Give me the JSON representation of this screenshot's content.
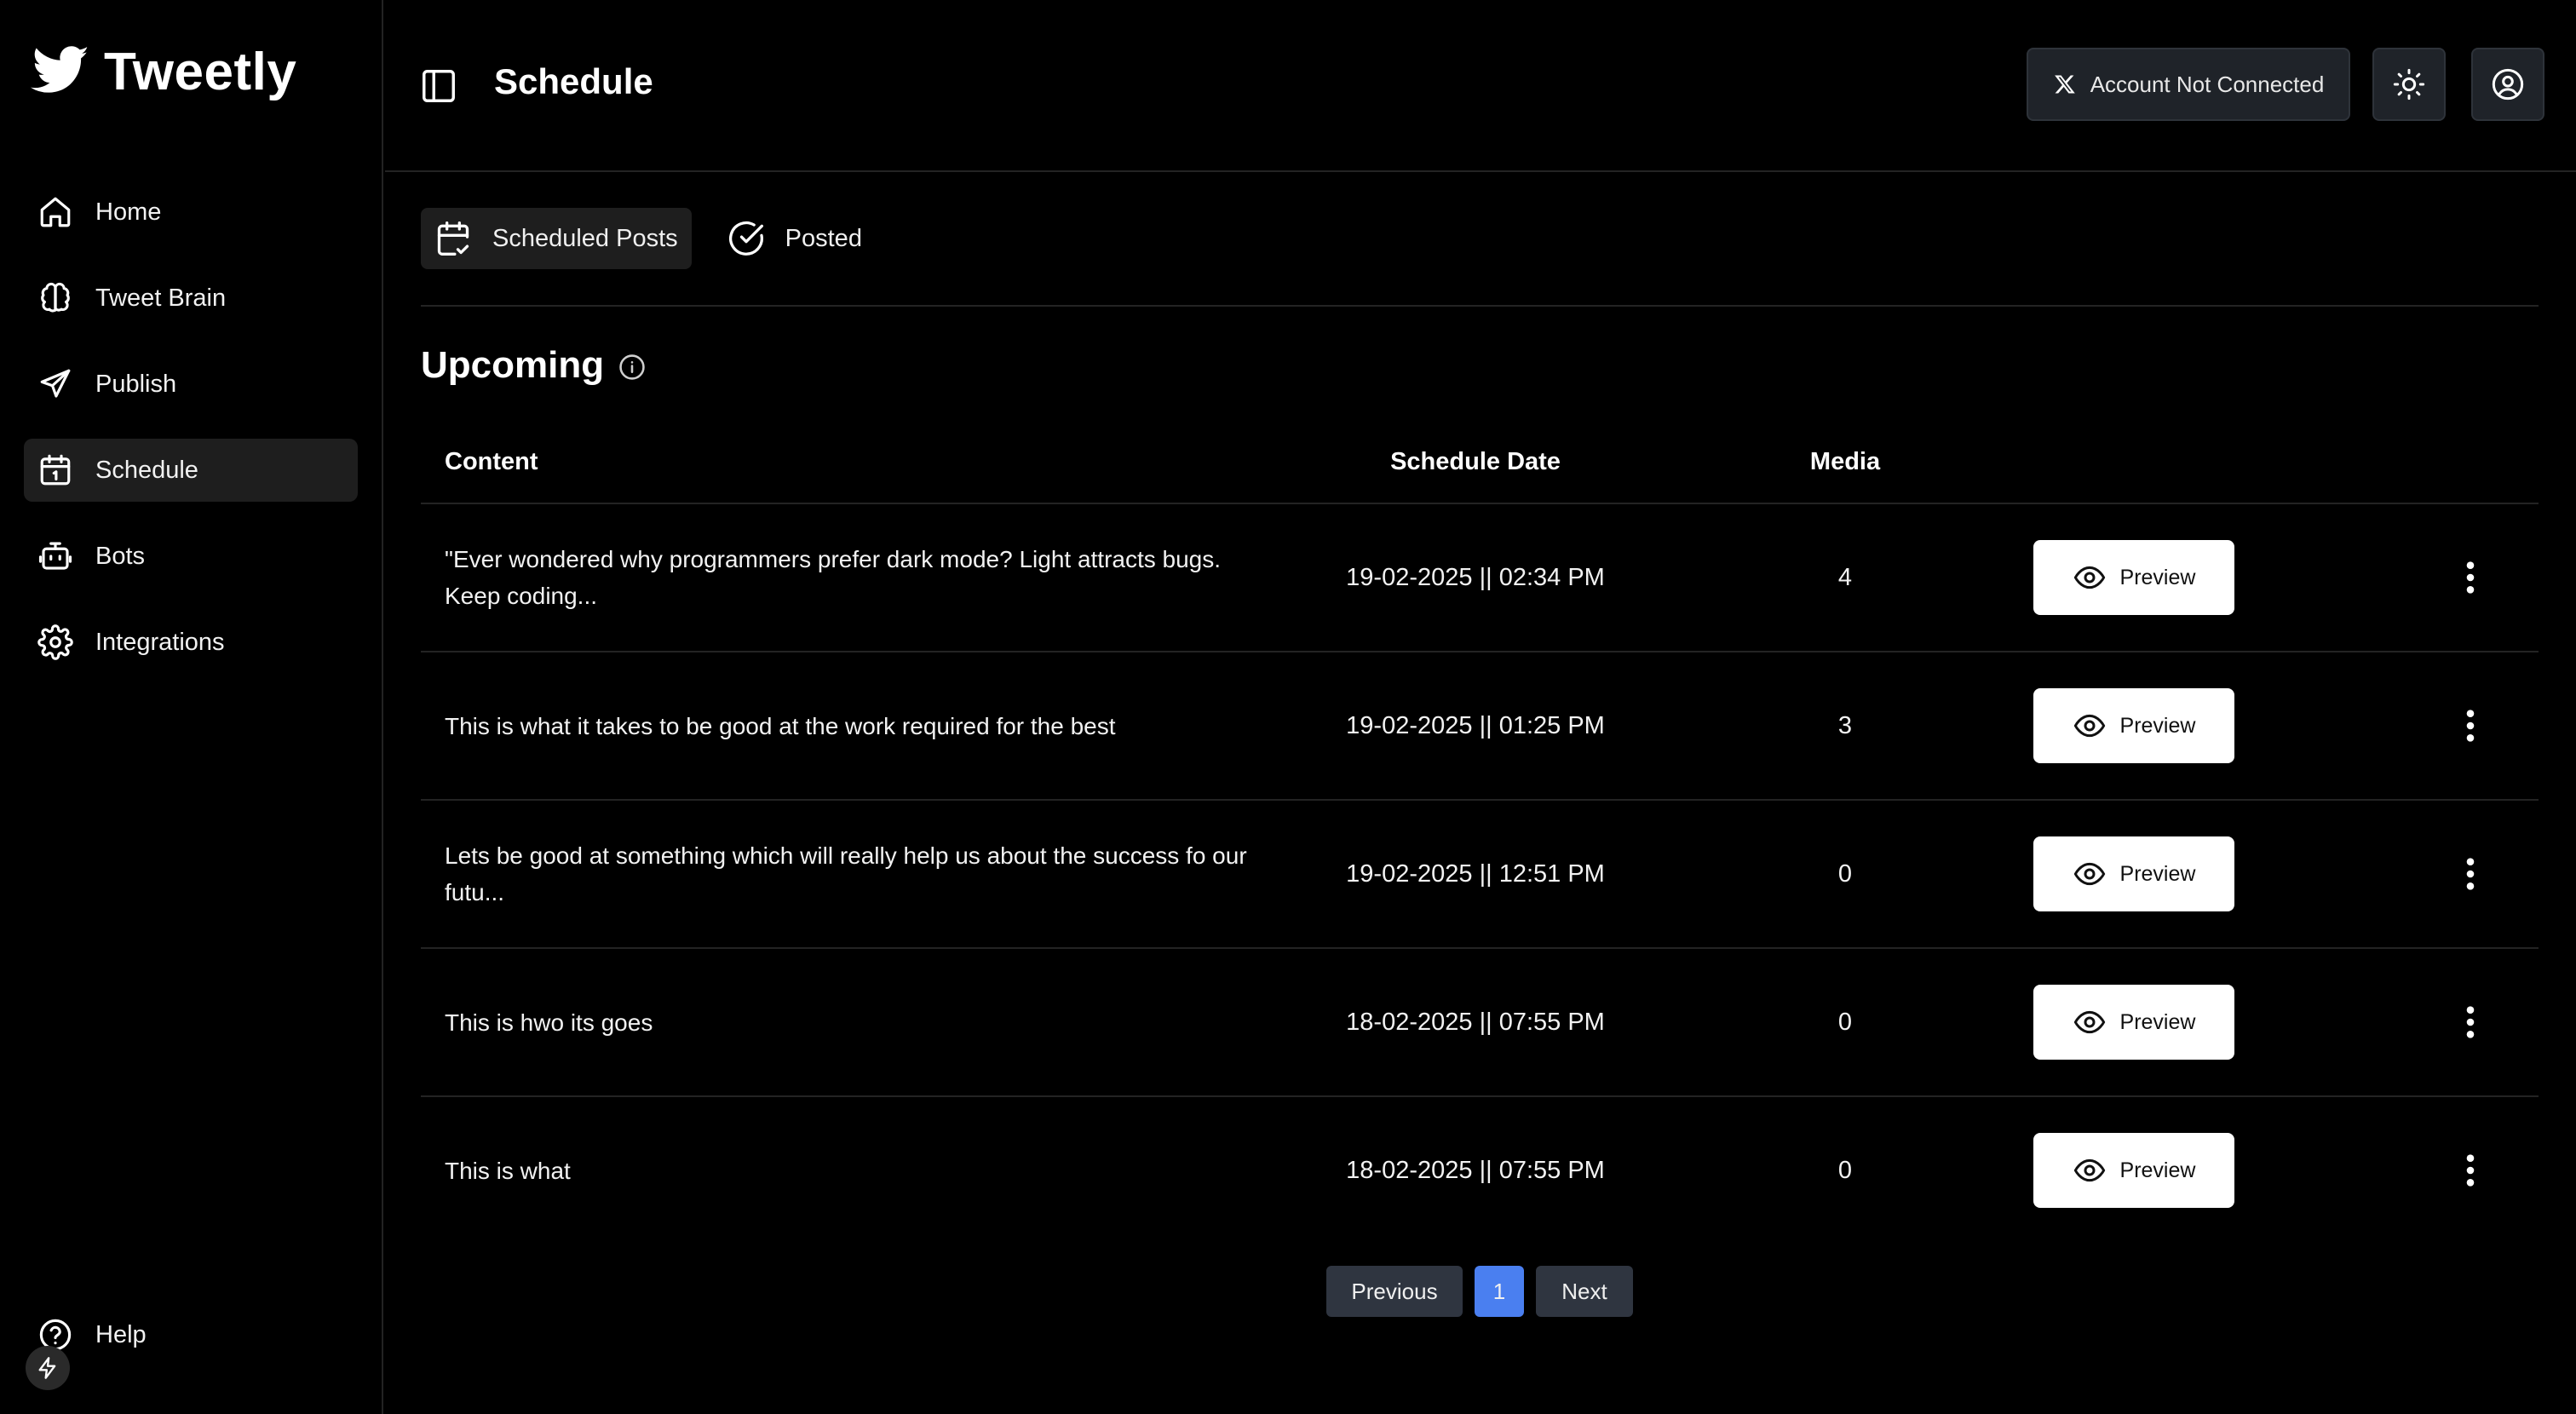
{
  "app": {
    "name": "Tweetly"
  },
  "sidebar": {
    "items": [
      {
        "label": "Home",
        "icon": "home-icon"
      },
      {
        "label": "Tweet Brain",
        "icon": "brain-icon"
      },
      {
        "label": "Publish",
        "icon": "send-icon"
      },
      {
        "label": "Schedule",
        "icon": "calendar-icon",
        "active": true
      },
      {
        "label": "Bots",
        "icon": "bot-icon"
      },
      {
        "label": "Integrations",
        "icon": "gear-icon"
      }
    ],
    "help_label": "Help"
  },
  "header": {
    "title": "Schedule",
    "account_label": "Account Not Connected"
  },
  "tabs": [
    {
      "label": "Scheduled Posts",
      "icon": "calendar-check-icon",
      "active": true
    },
    {
      "label": "Posted",
      "icon": "check-circle-icon"
    }
  ],
  "section": {
    "title": "Upcoming"
  },
  "table": {
    "columns": {
      "content": "Content",
      "date": "Schedule Date",
      "media": "Media"
    },
    "preview_label": "Preview",
    "rows": [
      {
        "content": "\"Ever wondered why programmers prefer dark mode? Light attracts bugs. Keep coding...",
        "date": "19-02-2025 || 02:34 PM",
        "media": "4"
      },
      {
        "content": "This is what it takes to be good at the work required for the best",
        "date": "19-02-2025 || 01:25 PM",
        "media": "3"
      },
      {
        "content": "Lets be good at something which will really help us about the success fo our futu...",
        "date": "19-02-2025 || 12:51 PM",
        "media": "0"
      },
      {
        "content": "This is hwo its goes",
        "date": "18-02-2025 || 07:55 PM",
        "media": "0"
      },
      {
        "content": "This is what",
        "date": "18-02-2025 || 07:55 PM",
        "media": "0"
      }
    ]
  },
  "pagination": {
    "previous": "Previous",
    "current": "1",
    "next": "Next"
  },
  "colors": {
    "background": "#000000",
    "surface": "#1e1e1e",
    "accent": "#4a7ff0",
    "button_dark": "#2f3540"
  }
}
